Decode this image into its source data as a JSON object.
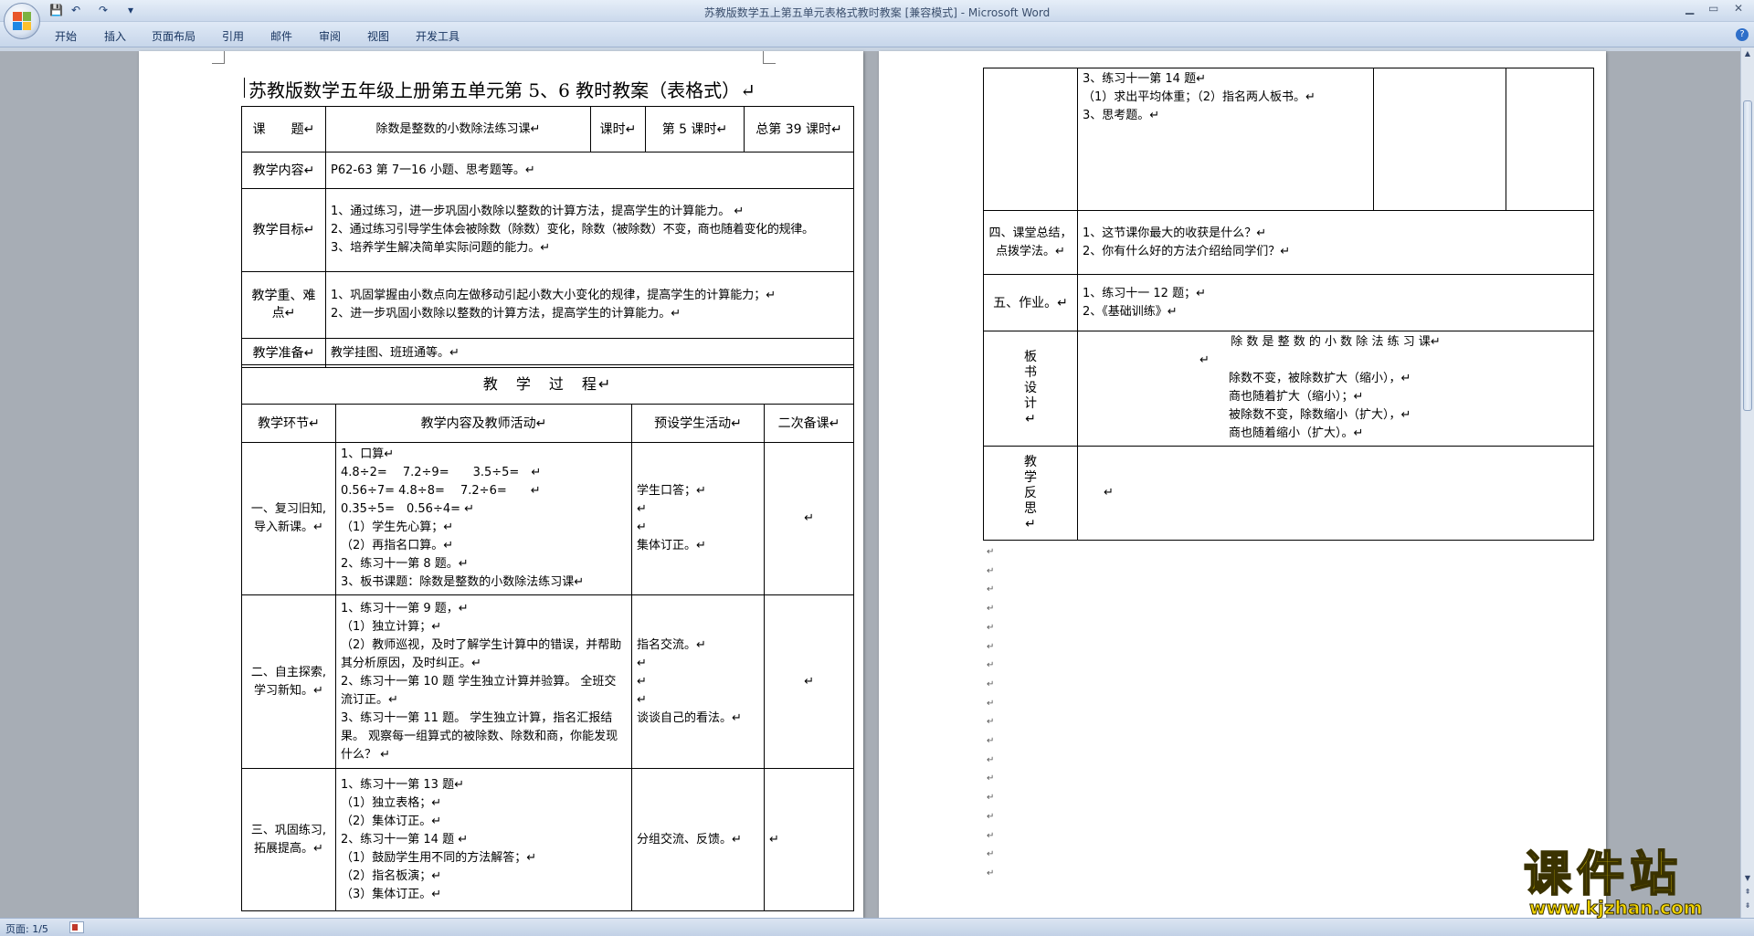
{
  "window": {
    "title": "苏教版数学五上第五单元表格式教时教案 [兼容模式] - Microsoft Word",
    "controls": [
      "▁",
      "▭",
      "✕"
    ]
  },
  "ribbon": {
    "tabs": [
      "开始",
      "插入",
      "页面布局",
      "引用",
      "邮件",
      "审阅",
      "视图",
      "开发工具"
    ]
  },
  "quick_access": {
    "save": "💾",
    "undo": "↶",
    "redo": "↷",
    "more": "▾"
  },
  "document": {
    "title": "苏教版数学五年级上册第五单元第 5、6 教时教案（表格式）↵",
    "header_rows": {
      "topic_label": "课　　题↵",
      "topic_value": "除数是整数的小数除法练习课↵",
      "period_label": "课时↵",
      "period_value": "第 5 课时↵",
      "total_value": "总第 39 课时↵",
      "content_label": "教学内容↵",
      "content_value": "P62-63 第 7一16 小题、思考题等。↵",
      "goal_label": "教学目标↵",
      "goal_lines": [
        "1、通过练习，进一步巩固小数除以整数的计算方法，提高学生的计算能力。 ↵",
        "2、通过练习引导学生体会被除数（除数）变化，除数（被除数）不变，商也随着变化的规律。",
        "3、培养学生解决简单实际问题的能力。↵"
      ],
      "key_label": "教学重、难点↵",
      "key_lines": [
        "1、巩固掌握由小数点向左做移动引起小数大小变化的规律，提高学生的计算能力；↵",
        "2、进一步巩固小数除以整数的计算方法，提高学生的计算能力。↵"
      ],
      "prep_label": "教学准备↵",
      "prep_value": "教学挂图、班班通等。↵"
    },
    "process": {
      "heading": "教　学　过　程↵",
      "columns": [
        "教学环节↵",
        "教学内容及教师活动↵",
        "预设学生活动↵",
        "二次备课↵"
      ],
      "rows": [
        {
          "stage": "一、复习旧知,导入新课。↵",
          "content": [
            "1、口算↵",
            " 4.8÷2=　 7.2÷9=　　3.5÷5=　↵",
            " 0.56÷7= 4.8÷8=　 7.2÷6=　　↵",
            " 0.35÷5=　0.56÷4= ↵",
            "（1）学生先心算；↵",
            "（2）再指名口算。↵",
            "2、练习十一第 8 题。↵",
            "3、板书课题：除数是整数的小数除法练习课↵"
          ],
          "student": [
            "学生口答；↵",
            "↵",
            "↵",
            "集体订正。↵"
          ],
          "notes": "↵"
        },
        {
          "stage": "二、自主探索,学习新知。↵",
          "content": [
            "1、练习十一第 9 题，↵",
            "（1）独立计算；↵",
            "（2）教师巡视，及时了解学生计算中的错误，并帮助其分析原因，及时纠正。↵",
            "2、练习十一第 10 题 学生独立计算并验算。 全班交流订正。↵",
            "3、练习十一第 11 题。 学生独立计算，指名汇报结果。 观察每一组算式的被除数、除数和商，你能发现什么？ ↵"
          ],
          "student": [
            "指名交流。↵",
            "↵",
            "↵",
            "↵",
            "谈谈自己的看法。↵"
          ],
          "notes": "↵"
        },
        {
          "stage": "三、巩固练习,拓展提高。↵",
          "content": [
            "1、练习十一第 13 题↵",
            "（1）独立表格；↵",
            "（2）集体订正。↵",
            "2、练习十一第 14 题 ↵",
            "（1）鼓励学生用不同的方法解答；↵",
            "（2）指名板演；↵",
            "（3）集体订正。↵"
          ],
          "student": [
            "分组交流、反馈。↵"
          ],
          "notes": "↵"
        }
      ]
    },
    "page2": {
      "cont_lines": [
        "3、练习十一第 14 题↵",
        "（1）求出平均体重；（2）指名两人板书。↵",
        "3、思考题。↵"
      ],
      "summary_label": "四、课堂总结，点拨学法。↵",
      "summary_lines": [
        "1、这节课你最大的收获是什么？↵",
        "2、你有什么好的方法介绍给同学们？↵"
      ],
      "homework_label": "五、作业。↵",
      "homework_lines": [
        "1、练习十一 12 题；↵",
        "2、《基础训练》↵"
      ],
      "board_label": "板书设计↵",
      "board_title": "除 数 是 整 数 的 小 数 除 法 练 习 课↵",
      "board_lines": [
        "↵",
        "除数不变，被除数扩大（缩小），↵",
        "商也随着扩大（缩小）；↵",
        "被除数不变，除数缩小（扩大），↵",
        "商也随着缩小（扩大）。↵"
      ],
      "reflect_label": "教学反思↵",
      "reflect_value": "↵",
      "trailing_marks": [
        "↵",
        "↵",
        "↵",
        "↵",
        "↵",
        "↵",
        "↵",
        "↵",
        "↵",
        "↵",
        "↵",
        "↵",
        "↵",
        "↵",
        "↵",
        "↵",
        "↵",
        "↵"
      ]
    }
  },
  "status": {
    "page_indicator": "页面: 1/5"
  },
  "watermark": {
    "brand": "课件站",
    "url": "www.kjzhan.com"
  },
  "colors": {
    "accent": "#2f6fc9",
    "watermark": "#f2d400"
  }
}
